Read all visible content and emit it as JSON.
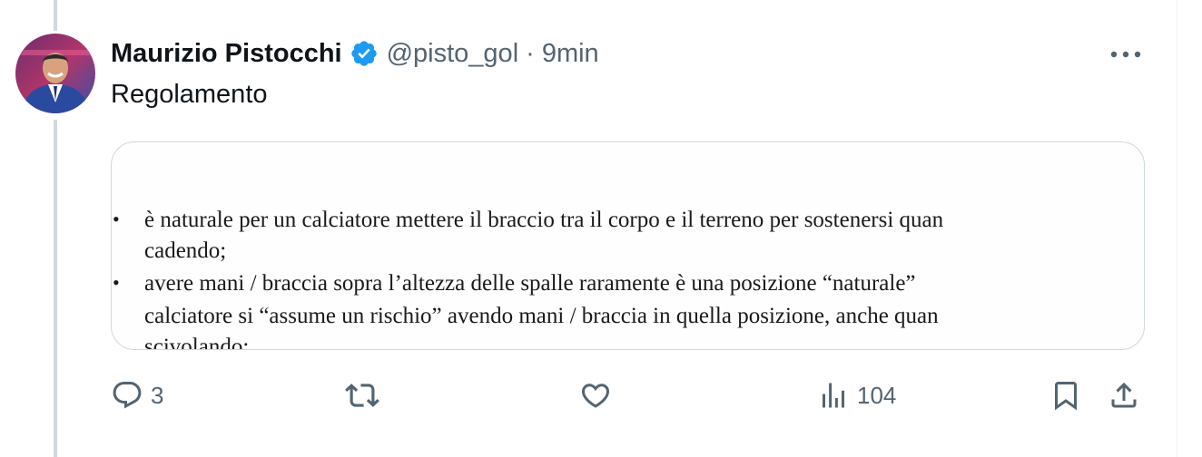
{
  "author": {
    "display_name": "Maurizio Pistocchi",
    "handle": "@pisto_gol",
    "separator": "·",
    "time": "9min",
    "verified": true,
    "avatar_icon": "profile-photo"
  },
  "tweet": {
    "text": "Regolamento"
  },
  "media": {
    "document_lines": [
      {
        "bullet": "•",
        "text": "è naturale per un calciatore mettere il braccio tra il corpo e il terreno per sostenersi quan"
      },
      {
        "bullet": "",
        "text": "cadendo;"
      },
      {
        "bullet": "•",
        "text": "avere mani / braccia sopra l’altezza delle spalle raramente è una posizione “naturale”"
      },
      {
        "bullet": "",
        "text": "calciatore si “assume un rischio” avendo mani / braccia in quella posizione, anche quan"
      },
      {
        "bullet": "",
        "text": "scivolando;"
      }
    ]
  },
  "actions": {
    "reply": {
      "icon": "reply-icon",
      "count": "3"
    },
    "retweet": {
      "icon": "retweet-icon",
      "count": ""
    },
    "like": {
      "icon": "heart-icon",
      "count": ""
    },
    "views": {
      "icon": "views-icon",
      "count": "104"
    },
    "bookmark": {
      "icon": "bookmark-icon"
    },
    "share": {
      "icon": "share-icon"
    }
  },
  "colors": {
    "text_primary": "#0f1419",
    "text_secondary": "#536471",
    "verified_blue": "#1d9bf0",
    "border": "#cfd9de"
  }
}
